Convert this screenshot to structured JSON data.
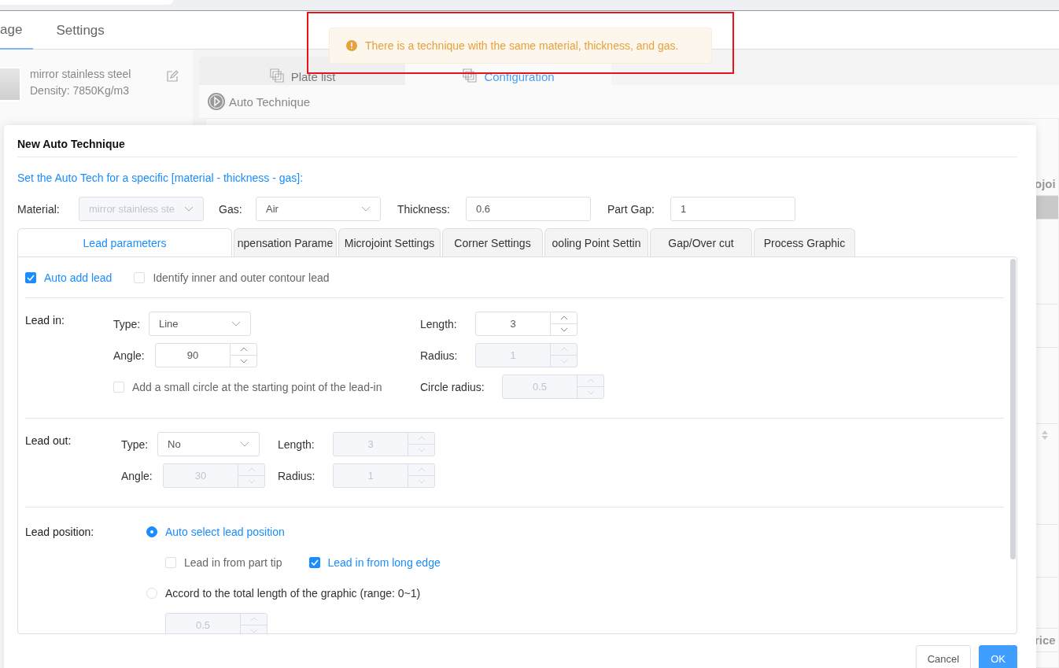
{
  "background": {
    "nav_tabs": [
      {
        "label": "age",
        "selected": true
      },
      {
        "label": "Settings",
        "selected": false
      }
    ],
    "material_card": {
      "name": "mirror stainless steel",
      "density": "Density:  7850Kg/m3"
    },
    "panel_tabs": [
      {
        "label": "Plate list",
        "selected": false
      },
      {
        "label": "Configuration",
        "selected": true
      }
    ],
    "section_title": "Auto Technique",
    "table_header_fragment": "ojoi",
    "table_footer_fragment": "rice"
  },
  "toast": {
    "kind": "warning",
    "message": "There is a technique with the same material, thickness, and gas."
  },
  "dialog": {
    "title": "New Auto Technique",
    "subtitle": "Set the Auto Tech for a specific [material - thickness - gas]:",
    "fields": [
      {
        "kind": "select",
        "label": "Material:",
        "value": "mirror stainless ste",
        "disabled": true
      },
      {
        "kind": "select",
        "label": "Gas:",
        "value": "Air",
        "disabled": false
      },
      {
        "kind": "input",
        "label": "Thickness:",
        "value": "0.6",
        "disabled": false
      },
      {
        "kind": "input",
        "label": "Part Gap:",
        "value": "1",
        "disabled": false
      }
    ],
    "tabs": [
      {
        "label": "Lead parameters",
        "selected": true
      },
      {
        "label": "npensation Parame",
        "selected": false
      },
      {
        "label": "Microjoint Settings",
        "selected": false
      },
      {
        "label": "Corner Settings",
        "selected": false
      },
      {
        "label": "ooling Point Settin",
        "selected": false
      },
      {
        "label": "Gap/Over cut",
        "selected": false
      },
      {
        "label": "Process Graphic",
        "selected": false
      }
    ],
    "options": [
      {
        "label": "Auto add lead",
        "checked": true
      },
      {
        "label": "Identify inner and outer contour lead",
        "checked": false
      }
    ],
    "lead_in": {
      "label": "Lead in:",
      "type": {
        "label": "Type:",
        "value": "Line"
      },
      "length": {
        "label": "Length:",
        "value": "3",
        "disabled": false
      },
      "angle": {
        "label": "Angle:",
        "value": "90",
        "disabled": false
      },
      "radius": {
        "label": "Radius:",
        "value": "1",
        "disabled": true
      },
      "small_circle": {
        "label": "Add a small circle at the starting point of the lead-in",
        "checked": false
      },
      "circle_radius": {
        "label": "Circle radius:",
        "value": "0.5",
        "disabled": true
      }
    },
    "lead_out": {
      "label": "Lead out:",
      "type": {
        "label": "Type:",
        "value": "No"
      },
      "length": {
        "label": "Length:",
        "value": "3",
        "disabled": true
      },
      "angle": {
        "label": "Angle:",
        "value": "30",
        "disabled": true
      },
      "radius": {
        "label": "Radius:",
        "value": "1",
        "disabled": true
      }
    },
    "lead_position": {
      "label": "Lead position:",
      "modes": [
        {
          "label": "Auto select lead position",
          "selected": true
        },
        {
          "label": "Accord to the total length of the graphic (range: 0~1)",
          "selected": false
        }
      ],
      "auto_options": [
        {
          "label": "Lead in from part tip",
          "checked": false
        },
        {
          "label": "Lead in from long edge",
          "checked": true
        }
      ],
      "ratio": {
        "value": "0.5",
        "disabled": true
      }
    },
    "buttons": [
      {
        "kind": "secondary",
        "label": "Cancel"
      },
      {
        "kind": "primary",
        "label": "OK"
      }
    ]
  }
}
